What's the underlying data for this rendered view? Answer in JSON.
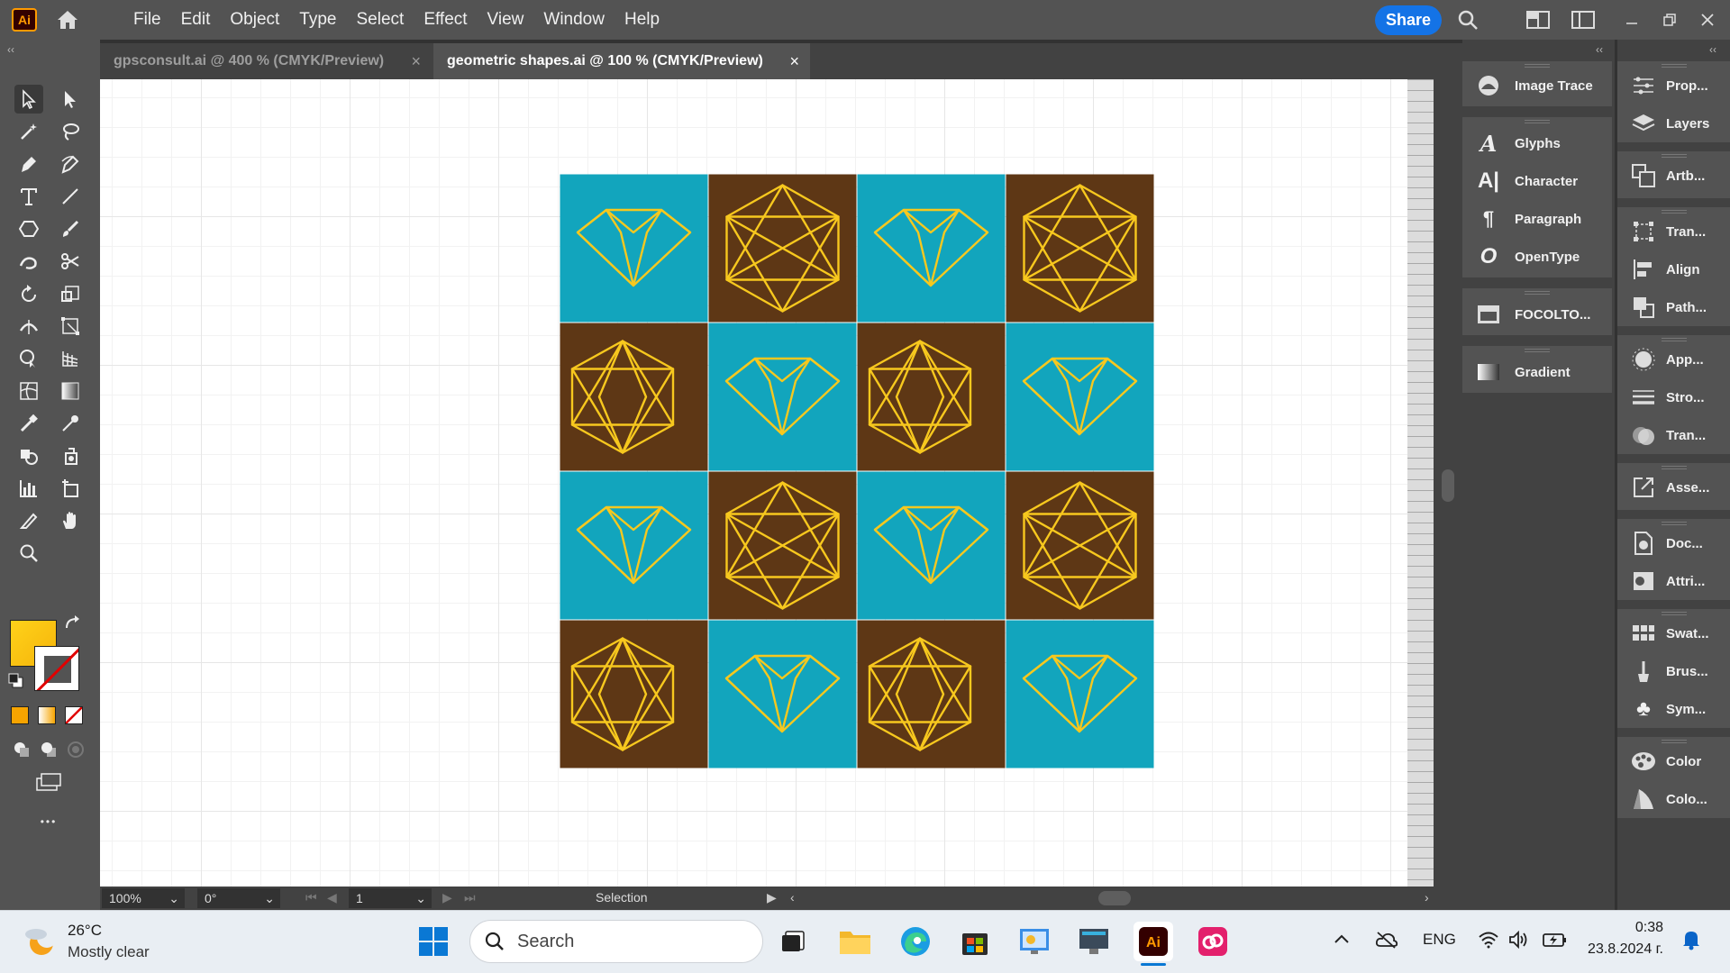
{
  "app": {
    "logo_text": "Ai",
    "share_label": "Share"
  },
  "menu": [
    "File",
    "Edit",
    "Object",
    "Type",
    "Select",
    "Effect",
    "View",
    "Window",
    "Help"
  ],
  "tabs": [
    {
      "label": "gpsconsult.ai @ 400 % (CMYK/Preview)",
      "close": "×",
      "active": false
    },
    {
      "label": "geometric shapes.ai @ 100 % (CMYK/Preview)",
      "close": "×",
      "active": true
    }
  ],
  "colors": {
    "teal": "#12a5bd",
    "brown": "#5e3715",
    "gold": "#f7c81e",
    "fill": "#ffd21a",
    "accent": "#1473e6"
  },
  "pattern_grid": [
    [
      "diamond",
      "hexagon",
      "diamond",
      "hexagon"
    ],
    [
      "star",
      "diamond",
      "star",
      "diamond"
    ],
    [
      "diamond",
      "hexagon",
      "diamond",
      "hexagon"
    ],
    [
      "star",
      "diamond",
      "star",
      "diamond"
    ]
  ],
  "statusbar": {
    "zoom": "100%",
    "rotation": "0°",
    "artboard": "1",
    "mode": "Selection"
  },
  "panel1": [
    "Image Trace",
    "Glyphs",
    "Character",
    "Paragraph",
    "OpenType",
    "FOCOLTO...",
    "Gradient"
  ],
  "panel2": [
    "Prop...",
    "Layers",
    "Artb...",
    "Tran...",
    "Align",
    "Path...",
    "App...",
    "Stro...",
    "Tran...",
    "Asse...",
    "Doc...",
    "Attri...",
    "Swat...",
    "Brus...",
    "Sym...",
    "Color",
    "Colo..."
  ],
  "toolbar": {
    "more": "•••"
  },
  "taskbar": {
    "temperature": "26°C",
    "weather": "Mostly clear",
    "search_placeholder": "Search",
    "language": "ENG",
    "time": "0:38",
    "date": "23.8.2024 г."
  }
}
